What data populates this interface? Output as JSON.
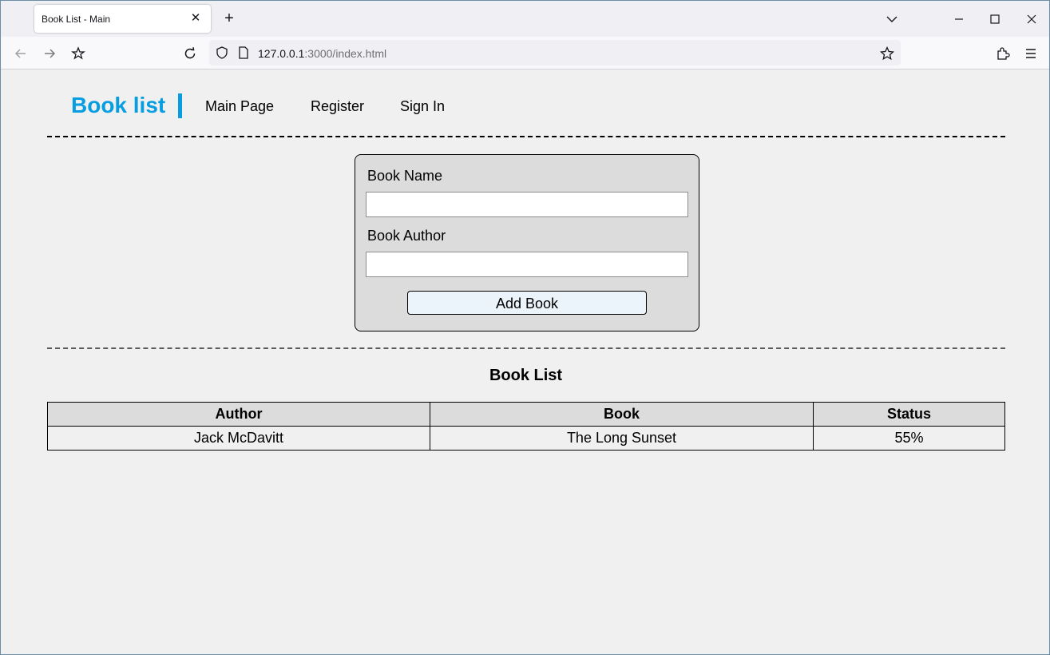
{
  "browser": {
    "tab_title": "Book List - Main",
    "url_host": "127.0.0.1",
    "url_rest": ":3000/index.html"
  },
  "header": {
    "brand": "Book list",
    "nav": [
      "Main Page",
      "Register",
      "Sign In"
    ],
    "brand_color": "#069ee0"
  },
  "form": {
    "book_name_label": "Book Name",
    "book_name_value": "",
    "book_author_label": "Book Author",
    "book_author_value": "",
    "add_button": "Add Book"
  },
  "book_list": {
    "title": "Book List",
    "columns": [
      "Author",
      "Book",
      "Status"
    ],
    "rows": [
      {
        "author": "Jack McDavitt",
        "book": "The Long Sunset",
        "status": "55%"
      }
    ]
  }
}
